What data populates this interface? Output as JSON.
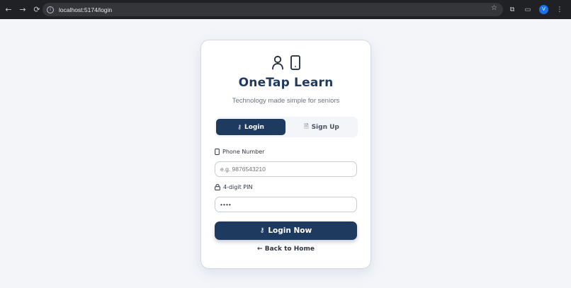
{
  "browser": {
    "back_icon": "←",
    "forward_icon": "→",
    "reload_icon": "⟳",
    "site_info_icon": "i",
    "url": "localhost:5174/login",
    "star_icon": "☆",
    "extensions_icon": "⧉",
    "media_icon": "▭",
    "profile_initial": "V",
    "menu_icon": "⋮"
  },
  "card": {
    "brand": "OneTap Learn",
    "tagline": "Technology made simple for seniors",
    "tabs": [
      {
        "label": "Login",
        "icon": "key-icon",
        "active": true
      },
      {
        "label": "Sign Up",
        "icon": "document-icon",
        "active": false
      }
    ],
    "phone": {
      "label": "Phone Number",
      "placeholder": "e.g. 9876543210",
      "value": ""
    },
    "pin": {
      "label": "4-digit PIN",
      "value": "••••"
    },
    "submit_label": "Login Now",
    "back_label": "← Back to Home"
  },
  "colors": {
    "primary": "#1f3a5f",
    "background": "#f3f5f9",
    "card": "#ffffff"
  }
}
